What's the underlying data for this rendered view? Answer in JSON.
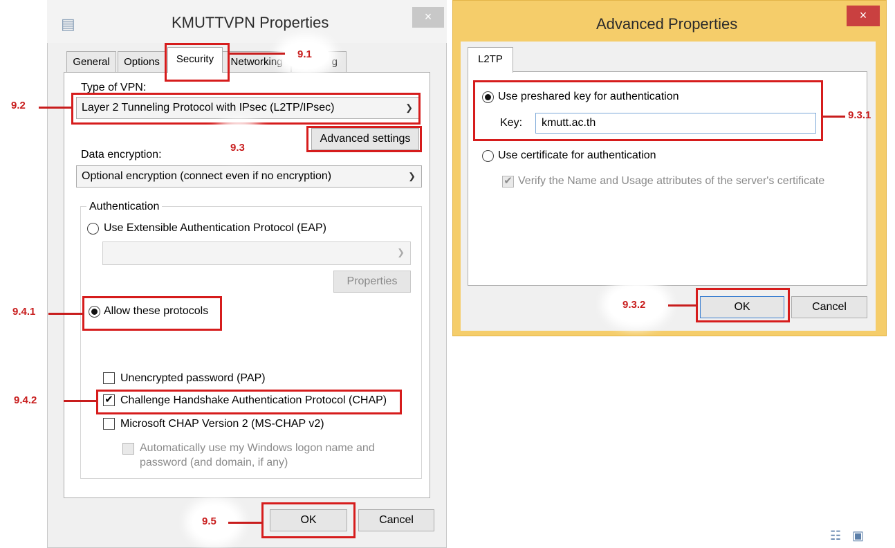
{
  "left_dialog": {
    "title": "KMUTTVPN Properties",
    "close_glyph": "×",
    "tabs": [
      "General",
      "Options",
      "Security",
      "Networking",
      "g"
    ],
    "type_of_vpn_label": "Type of VPN:",
    "type_of_vpn_value": "Layer 2 Tunneling Protocol with IPsec (L2TP/IPsec)",
    "advanced_settings_label": "Advanced settings",
    "data_encryption_label": "Data encryption:",
    "data_encryption_value": "Optional encryption (connect even if no encryption)",
    "authentication_label": "Authentication",
    "eap_label": "Use Extensible Authentication Protocol (EAP)",
    "eap_properties_label": "Properties",
    "allow_protocols_label": "Allow these protocols",
    "pap_label": "Unencrypted password (PAP)",
    "chap_label": "Challenge Handshake Authentication Protocol (CHAP)",
    "mschap_label": "Microsoft CHAP Version 2 (MS-CHAP v2)",
    "auto_logon_line1": "Automatically use my Windows logon name and",
    "auto_logon_line2": "password (and domain, if any)",
    "ok_label": "OK",
    "cancel_label": "Cancel",
    "chap_checked": true,
    "pap_checked": false,
    "mschap_checked": false
  },
  "right_dialog": {
    "title": "Advanced Properties",
    "close_glyph": "×",
    "tab": "L2TP",
    "preshared_label": "Use preshared key for authentication",
    "key_label": "Key:",
    "key_value": "kmutt.ac.th",
    "certificate_label": "Use certificate for authentication",
    "verify_label": "Verify the Name and Usage attributes of the server's certificate",
    "ok_label": "OK",
    "cancel_label": "Cancel"
  },
  "annotations": {
    "step_9_1": "9.1",
    "step_9_2": "9.2",
    "step_9_3": "9.3",
    "step_9_3_1": "9.3.1",
    "step_9_3_2": "9.3.2",
    "step_9_4_1": "9.4.1",
    "step_9_4_2": "9.4.2",
    "step_9_5": "9.5"
  },
  "icons": {
    "doc_icon": "▤",
    "view_details_icon": "☷",
    "view_tiles_icon": "▣"
  },
  "colors": {
    "annotation_red": "#c81d1d",
    "active_window_border": "#f5cd6a"
  }
}
